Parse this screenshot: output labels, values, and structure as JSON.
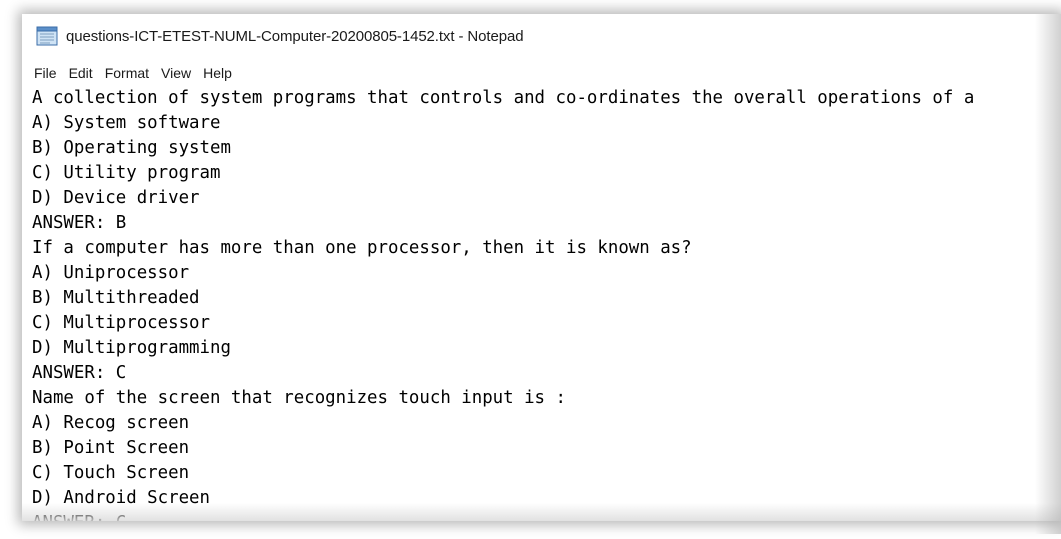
{
  "window": {
    "title": "questions-ICT-ETEST-NUML-Computer-20200805-1452.txt - Notepad",
    "app_icon": "notepad-icon"
  },
  "menubar": {
    "items": [
      "File",
      "Edit",
      "Format",
      "View",
      "Help"
    ]
  },
  "editor": {
    "lines": [
      "A collection of system programs that controls and co-ordinates the overall operations of a",
      "A) System software",
      "B) Operating system",
      "C) Utility program",
      "D) Device driver",
      "ANSWER: B",
      "If a computer has more than one processor, then it is known as?",
      "A) Uniprocessor",
      "B) Multithreaded",
      "C) Multiprocessor",
      "D) Multiprogramming",
      "ANSWER: C",
      "Name of the screen that recognizes touch input is :",
      "A) Recog screen",
      "B) Point Screen",
      "C) Touch Screen",
      "D) Android Screen",
      "ANSWER: C"
    ]
  },
  "colors": {
    "text": "#000000",
    "background": "#ffffff",
    "chrome_text": "#1a1a1a"
  }
}
